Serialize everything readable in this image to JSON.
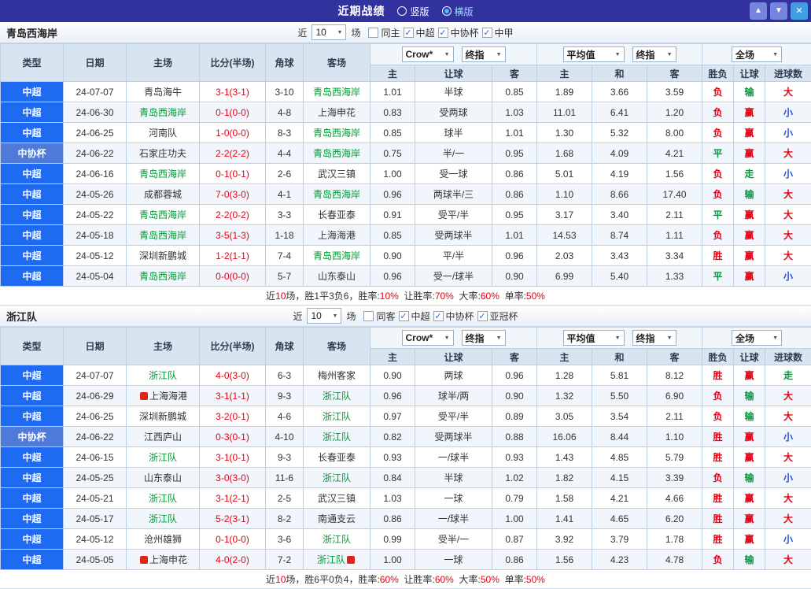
{
  "palette": {
    "red": "#e60012",
    "green": "#009a3d",
    "blue": "#2b50d9",
    "team_green": "#009933",
    "league_super": "#1e6af0",
    "league_cup": "#4f7ad8",
    "topbar": "#32329e",
    "black": "#333333"
  },
  "topbar": {
    "title": "近期战绩",
    "radios": [
      {
        "label": "竖版",
        "selected": false
      },
      {
        "label": "横版",
        "selected": true
      }
    ],
    "buttons": [
      {
        "name": "up",
        "glyph": "▲"
      },
      {
        "name": "down",
        "glyph": "▼"
      },
      {
        "name": "close",
        "glyph": "×"
      }
    ]
  },
  "labels": {
    "near": "近",
    "games": "场"
  },
  "columns": {
    "type": "类型",
    "date": "日期",
    "home": "主场",
    "score": "比分(半场)",
    "corner": "角球",
    "away": "客场",
    "sub": [
      "主",
      "让球",
      "客",
      "主",
      "和",
      "客",
      "胜负",
      "让球",
      "进球数"
    ]
  },
  "sections": [
    {
      "team": "青岛西海岸",
      "filter": {
        "count": "10",
        "checkboxes": [
          {
            "label": "同主",
            "checked": false
          },
          {
            "label": "中超",
            "checked": true
          },
          {
            "label": "中协杯",
            "checked": true
          },
          {
            "label": "中甲",
            "checked": true
          }
        ]
      },
      "selects": {
        "ah_source": "Crow*",
        "ah_time": "终指",
        "eu_source": "平均值",
        "eu_time": "终指",
        "scope": "全场"
      },
      "rows": [
        {
          "lg": "中超",
          "lgc": "super",
          "date": "24-07-07",
          "home": "青岛海牛",
          "hg": false,
          "hi": false,
          "score": "3-1(3-1)",
          "cor": "3-10",
          "away": "青岛西海岸",
          "ag": true,
          "ai": false,
          "ah": [
            "1.01",
            "半球",
            "0.85"
          ],
          "eu": [
            "1.89",
            "3.66",
            "3.59"
          ],
          "res": {
            "t": "负",
            "c": "red"
          },
          "ahr": {
            "t": "输",
            "c": "green"
          },
          "gl": {
            "t": "大",
            "c": "red"
          }
        },
        {
          "lg": "中超",
          "lgc": "super",
          "date": "24-06-30",
          "home": "青岛西海岸",
          "hg": true,
          "hi": false,
          "score": "0-1(0-0)",
          "cor": "4-8",
          "away": "上海申花",
          "ag": false,
          "ai": false,
          "ah": [
            "0.83",
            "受两球",
            "1.03"
          ],
          "eu": [
            "11.01",
            "6.41",
            "1.20"
          ],
          "res": {
            "t": "负",
            "c": "red"
          },
          "ahr": {
            "t": "赢",
            "c": "red"
          },
          "gl": {
            "t": "小",
            "c": "blue"
          }
        },
        {
          "lg": "中超",
          "lgc": "super",
          "date": "24-06-25",
          "home": "河南队",
          "hg": false,
          "hi": false,
          "score": "1-0(0-0)",
          "cor": "8-3",
          "away": "青岛西海岸",
          "ag": true,
          "ai": false,
          "ah": [
            "0.85",
            "球半",
            "1.01"
          ],
          "eu": [
            "1.30",
            "5.32",
            "8.00"
          ],
          "res": {
            "t": "负",
            "c": "red"
          },
          "ahr": {
            "t": "赢",
            "c": "red"
          },
          "gl": {
            "t": "小",
            "c": "blue"
          }
        },
        {
          "lg": "中协杯",
          "lgc": "cup",
          "date": "24-06-22",
          "home": "石家庄功夫",
          "hg": false,
          "hi": false,
          "score": "2-2(2-2)",
          "cor": "4-4",
          "away": "青岛西海岸",
          "ag": true,
          "ai": false,
          "ah": [
            "0.75",
            "半/一",
            "0.95"
          ],
          "eu": [
            "1.68",
            "4.09",
            "4.21"
          ],
          "res": {
            "t": "平",
            "c": "green"
          },
          "ahr": {
            "t": "赢",
            "c": "red"
          },
          "gl": {
            "t": "大",
            "c": "red"
          }
        },
        {
          "lg": "中超",
          "lgc": "super",
          "date": "24-06-16",
          "home": "青岛西海岸",
          "hg": true,
          "hi": false,
          "score": "0-1(0-1)",
          "cor": "2-6",
          "away": "武汉三镇",
          "ag": false,
          "ai": false,
          "ah": [
            "1.00",
            "受一球",
            "0.86"
          ],
          "eu": [
            "5.01",
            "4.19",
            "1.56"
          ],
          "res": {
            "t": "负",
            "c": "red"
          },
          "ahr": {
            "t": "走",
            "c": "green"
          },
          "gl": {
            "t": "小",
            "c": "blue"
          }
        },
        {
          "lg": "中超",
          "lgc": "super",
          "date": "24-05-26",
          "home": "成都蓉城",
          "hg": false,
          "hi": false,
          "score": "7-0(3-0)",
          "cor": "4-1",
          "away": "青岛西海岸",
          "ag": true,
          "ai": false,
          "ah": [
            "0.96",
            "两球半/三",
            "0.86"
          ],
          "eu": [
            "1.10",
            "8.66",
            "17.40"
          ],
          "res": {
            "t": "负",
            "c": "red"
          },
          "ahr": {
            "t": "输",
            "c": "green"
          },
          "gl": {
            "t": "大",
            "c": "red"
          }
        },
        {
          "lg": "中超",
          "lgc": "super",
          "date": "24-05-22",
          "home": "青岛西海岸",
          "hg": true,
          "hi": false,
          "score": "2-2(0-2)",
          "cor": "3-3",
          "away": "长春亚泰",
          "ag": false,
          "ai": false,
          "ah": [
            "0.91",
            "受平/半",
            "0.95"
          ],
          "eu": [
            "3.17",
            "3.40",
            "2.11"
          ],
          "res": {
            "t": "平",
            "c": "green"
          },
          "ahr": {
            "t": "赢",
            "c": "red"
          },
          "gl": {
            "t": "大",
            "c": "red"
          }
        },
        {
          "lg": "中超",
          "lgc": "super",
          "date": "24-05-18",
          "home": "青岛西海岸",
          "hg": true,
          "hi": false,
          "score": "3-5(1-3)",
          "cor": "1-18",
          "away": "上海海港",
          "ag": false,
          "ai": false,
          "ah": [
            "0.85",
            "受两球半",
            "1.01"
          ],
          "eu": [
            "14.53",
            "8.74",
            "1.11"
          ],
          "res": {
            "t": "负",
            "c": "red"
          },
          "ahr": {
            "t": "赢",
            "c": "red"
          },
          "gl": {
            "t": "大",
            "c": "red"
          }
        },
        {
          "lg": "中超",
          "lgc": "super",
          "date": "24-05-12",
          "home": "深圳新鹏城",
          "hg": false,
          "hi": false,
          "score": "1-2(1-1)",
          "cor": "7-4",
          "away": "青岛西海岸",
          "ag": true,
          "ai": false,
          "ah": [
            "0.90",
            "平/半",
            "0.96"
          ],
          "eu": [
            "2.03",
            "3.43",
            "3.34"
          ],
          "res": {
            "t": "胜",
            "c": "red"
          },
          "ahr": {
            "t": "赢",
            "c": "red"
          },
          "gl": {
            "t": "大",
            "c": "red"
          }
        },
        {
          "lg": "中超",
          "lgc": "super",
          "date": "24-05-04",
          "home": "青岛西海岸",
          "hg": true,
          "hi": false,
          "score": "0-0(0-0)",
          "cor": "5-7",
          "away": "山东泰山",
          "ag": false,
          "ai": false,
          "ah": [
            "0.96",
            "受一/球半",
            "0.90"
          ],
          "eu": [
            "6.99",
            "5.40",
            "1.33"
          ],
          "res": {
            "t": "平",
            "c": "green"
          },
          "ahr": {
            "t": "赢",
            "c": "red"
          },
          "gl": {
            "t": "小",
            "c": "blue"
          }
        }
      ],
      "summary": [
        {
          "t": "近",
          "c": "k"
        },
        {
          "t": "10",
          "c": "r"
        },
        {
          "t": "场，胜1平3负6，胜率:",
          "c": "k"
        },
        {
          "t": "10%",
          "c": "r"
        },
        {
          "t": "  让胜率:",
          "c": "k"
        },
        {
          "t": "70%",
          "c": "r"
        },
        {
          "t": "  大率:",
          "c": "k"
        },
        {
          "t": "60%",
          "c": "r"
        },
        {
          "t": "  单率:",
          "c": "k"
        },
        {
          "t": "50%",
          "c": "r"
        }
      ]
    },
    {
      "team": "浙江队",
      "filter": {
        "count": "10",
        "checkboxes": [
          {
            "label": "同客",
            "checked": false
          },
          {
            "label": "中超",
            "checked": true
          },
          {
            "label": "中协杯",
            "checked": true
          },
          {
            "label": "亚冠杯",
            "checked": true
          }
        ]
      },
      "selects": {
        "ah_source": "Crow*",
        "ah_time": "终指",
        "eu_source": "平均值",
        "eu_time": "终指",
        "scope": "全场"
      },
      "rows": [
        {
          "lg": "中超",
          "lgc": "super",
          "date": "24-07-07",
          "home": "浙江队",
          "hg": true,
          "hi": false,
          "score": "4-0(3-0)",
          "cor": "6-3",
          "away": "梅州客家",
          "ag": false,
          "ai": false,
          "ah": [
            "0.90",
            "两球",
            "0.96"
          ],
          "eu": [
            "1.28",
            "5.81",
            "8.12"
          ],
          "res": {
            "t": "胜",
            "c": "red"
          },
          "ahr": {
            "t": "赢",
            "c": "red"
          },
          "gl": {
            "t": "走",
            "c": "green"
          }
        },
        {
          "lg": "中超",
          "lgc": "super",
          "date": "24-06-29",
          "home": "上海海港",
          "hg": false,
          "hi": true,
          "score": "3-1(1-1)",
          "cor": "9-3",
          "away": "浙江队",
          "ag": true,
          "ai": false,
          "ah": [
            "0.96",
            "球半/两",
            "0.90"
          ],
          "eu": [
            "1.32",
            "5.50",
            "6.90"
          ],
          "res": {
            "t": "负",
            "c": "red"
          },
          "ahr": {
            "t": "输",
            "c": "green"
          },
          "gl": {
            "t": "大",
            "c": "red"
          }
        },
        {
          "lg": "中超",
          "lgc": "super",
          "date": "24-06-25",
          "home": "深圳新鹏城",
          "hg": false,
          "hi": false,
          "score": "3-2(0-1)",
          "cor": "4-6",
          "away": "浙江队",
          "ag": true,
          "ai": false,
          "ah": [
            "0.97",
            "受平/半",
            "0.89"
          ],
          "eu": [
            "3.05",
            "3.54",
            "2.11"
          ],
          "res": {
            "t": "负",
            "c": "red"
          },
          "ahr": {
            "t": "输",
            "c": "green"
          },
          "gl": {
            "t": "大",
            "c": "red"
          }
        },
        {
          "lg": "中协杯",
          "lgc": "cup",
          "date": "24-06-22",
          "home": "江西庐山",
          "hg": false,
          "hi": false,
          "score": "0-3(0-1)",
          "cor": "4-10",
          "away": "浙江队",
          "ag": true,
          "ai": false,
          "ah": [
            "0.82",
            "受两球半",
            "0.88"
          ],
          "eu": [
            "16.06",
            "8.44",
            "1.10"
          ],
          "res": {
            "t": "胜",
            "c": "red"
          },
          "ahr": {
            "t": "赢",
            "c": "red"
          },
          "gl": {
            "t": "小",
            "c": "blue"
          }
        },
        {
          "lg": "中超",
          "lgc": "super",
          "date": "24-06-15",
          "home": "浙江队",
          "hg": true,
          "hi": false,
          "score": "3-1(0-1)",
          "cor": "9-3",
          "away": "长春亚泰",
          "ag": false,
          "ai": false,
          "ah": [
            "0.93",
            "一/球半",
            "0.93"
          ],
          "eu": [
            "1.43",
            "4.85",
            "5.79"
          ],
          "res": {
            "t": "胜",
            "c": "red"
          },
          "ahr": {
            "t": "赢",
            "c": "red"
          },
          "gl": {
            "t": "大",
            "c": "red"
          }
        },
        {
          "lg": "中超",
          "lgc": "super",
          "date": "24-05-25",
          "home": "山东泰山",
          "hg": false,
          "hi": false,
          "score": "3-0(3-0)",
          "cor": "11-6",
          "away": "浙江队",
          "ag": true,
          "ai": false,
          "ah": [
            "0.84",
            "半球",
            "1.02"
          ],
          "eu": [
            "1.82",
            "4.15",
            "3.39"
          ],
          "res": {
            "t": "负",
            "c": "red"
          },
          "ahr": {
            "t": "输",
            "c": "green"
          },
          "gl": {
            "t": "小",
            "c": "blue"
          }
        },
        {
          "lg": "中超",
          "lgc": "super",
          "date": "24-05-21",
          "home": "浙江队",
          "hg": true,
          "hi": false,
          "score": "3-1(2-1)",
          "cor": "2-5",
          "away": "武汉三镇",
          "ag": false,
          "ai": false,
          "ah": [
            "1.03",
            "一球",
            "0.79"
          ],
          "eu": [
            "1.58",
            "4.21",
            "4.66"
          ],
          "res": {
            "t": "胜",
            "c": "red"
          },
          "ahr": {
            "t": "赢",
            "c": "red"
          },
          "gl": {
            "t": "大",
            "c": "red"
          }
        },
        {
          "lg": "中超",
          "lgc": "super",
          "date": "24-05-17",
          "home": "浙江队",
          "hg": true,
          "hi": false,
          "score": "5-2(3-1)",
          "cor": "8-2",
          "away": "南通支云",
          "ag": false,
          "ai": false,
          "ah": [
            "0.86",
            "一/球半",
            "1.00"
          ],
          "eu": [
            "1.41",
            "4.65",
            "6.20"
          ],
          "res": {
            "t": "胜",
            "c": "red"
          },
          "ahr": {
            "t": "赢",
            "c": "red"
          },
          "gl": {
            "t": "大",
            "c": "red"
          }
        },
        {
          "lg": "中超",
          "lgc": "super",
          "date": "24-05-12",
          "home": "沧州雄狮",
          "hg": false,
          "hi": false,
          "score": "0-1(0-0)",
          "cor": "3-6",
          "away": "浙江队",
          "ag": true,
          "ai": false,
          "ah": [
            "0.99",
            "受半/一",
            "0.87"
          ],
          "eu": [
            "3.92",
            "3.79",
            "1.78"
          ],
          "res": {
            "t": "胜",
            "c": "red"
          },
          "ahr": {
            "t": "赢",
            "c": "red"
          },
          "gl": {
            "t": "小",
            "c": "blue"
          }
        },
        {
          "lg": "中超",
          "lgc": "super",
          "date": "24-05-05",
          "home": "上海申花",
          "hg": false,
          "hi": true,
          "score": "4-0(2-0)",
          "cor": "7-2",
          "away": "浙江队",
          "ag": true,
          "ai": true,
          "ah": [
            "1.00",
            "一球",
            "0.86"
          ],
          "eu": [
            "1.56",
            "4.23",
            "4.78"
          ],
          "res": {
            "t": "负",
            "c": "red"
          },
          "ahr": {
            "t": "输",
            "c": "green"
          },
          "gl": {
            "t": "大",
            "c": "red"
          }
        }
      ],
      "summary": [
        {
          "t": "近",
          "c": "k"
        },
        {
          "t": "10",
          "c": "r"
        },
        {
          "t": "场，胜6平0负4，胜率:",
          "c": "k"
        },
        {
          "t": "60%",
          "c": "r"
        },
        {
          "t": "  让胜率:",
          "c": "k"
        },
        {
          "t": "60%",
          "c": "r"
        },
        {
          "t": "  大率:",
          "c": "k"
        },
        {
          "t": "50%",
          "c": "r"
        },
        {
          "t": "  单率:",
          "c": "k"
        },
        {
          "t": "50%",
          "c": "r"
        }
      ]
    }
  ]
}
